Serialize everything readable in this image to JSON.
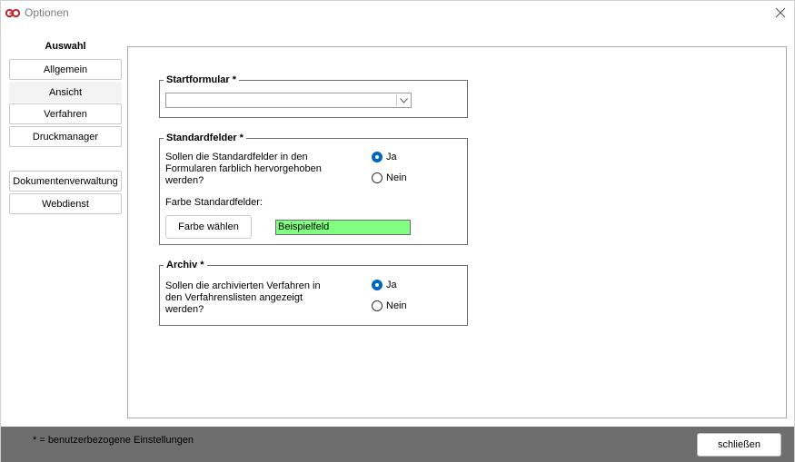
{
  "window": {
    "title": "Optionen",
    "accent_color": "#0067c0",
    "logo_color": "#c0282e"
  },
  "nav": {
    "heading": "Auswahl",
    "items": [
      {
        "label": "Allgemein",
        "selected": false
      },
      {
        "label": "Ansicht",
        "selected": true
      },
      {
        "label": "Verfahren",
        "selected": false
      },
      {
        "label": "Druckmanager",
        "selected": false
      },
      {
        "label": "Dokumentenverwaltung",
        "selected": false
      },
      {
        "label": "Webdienst",
        "selected": false
      }
    ]
  },
  "startformular": {
    "legend": "Startformular *",
    "value": ""
  },
  "standardfelder": {
    "legend": "Standardfelder *",
    "question": "Sollen die Standardfelder in den Formularen farblich hervorgehoben werden?",
    "option_yes": "Ja",
    "option_no": "Nein",
    "selected": "Ja",
    "color_label": "Farbe Standardfelder:",
    "choose_color_button": "Farbe wählen",
    "sample_text": "Beispielfeld",
    "sample_color": "#80ff80"
  },
  "archiv": {
    "legend": "Archiv *",
    "question": "Sollen die archivierten Verfahren in den Verfahrenslisten angezeigt werden?",
    "option_yes": "Ja",
    "option_no": "Nein",
    "selected": "Ja"
  },
  "footer": {
    "note": "*  = benutzerbezogene Einstellungen",
    "close_button": "schließen"
  }
}
